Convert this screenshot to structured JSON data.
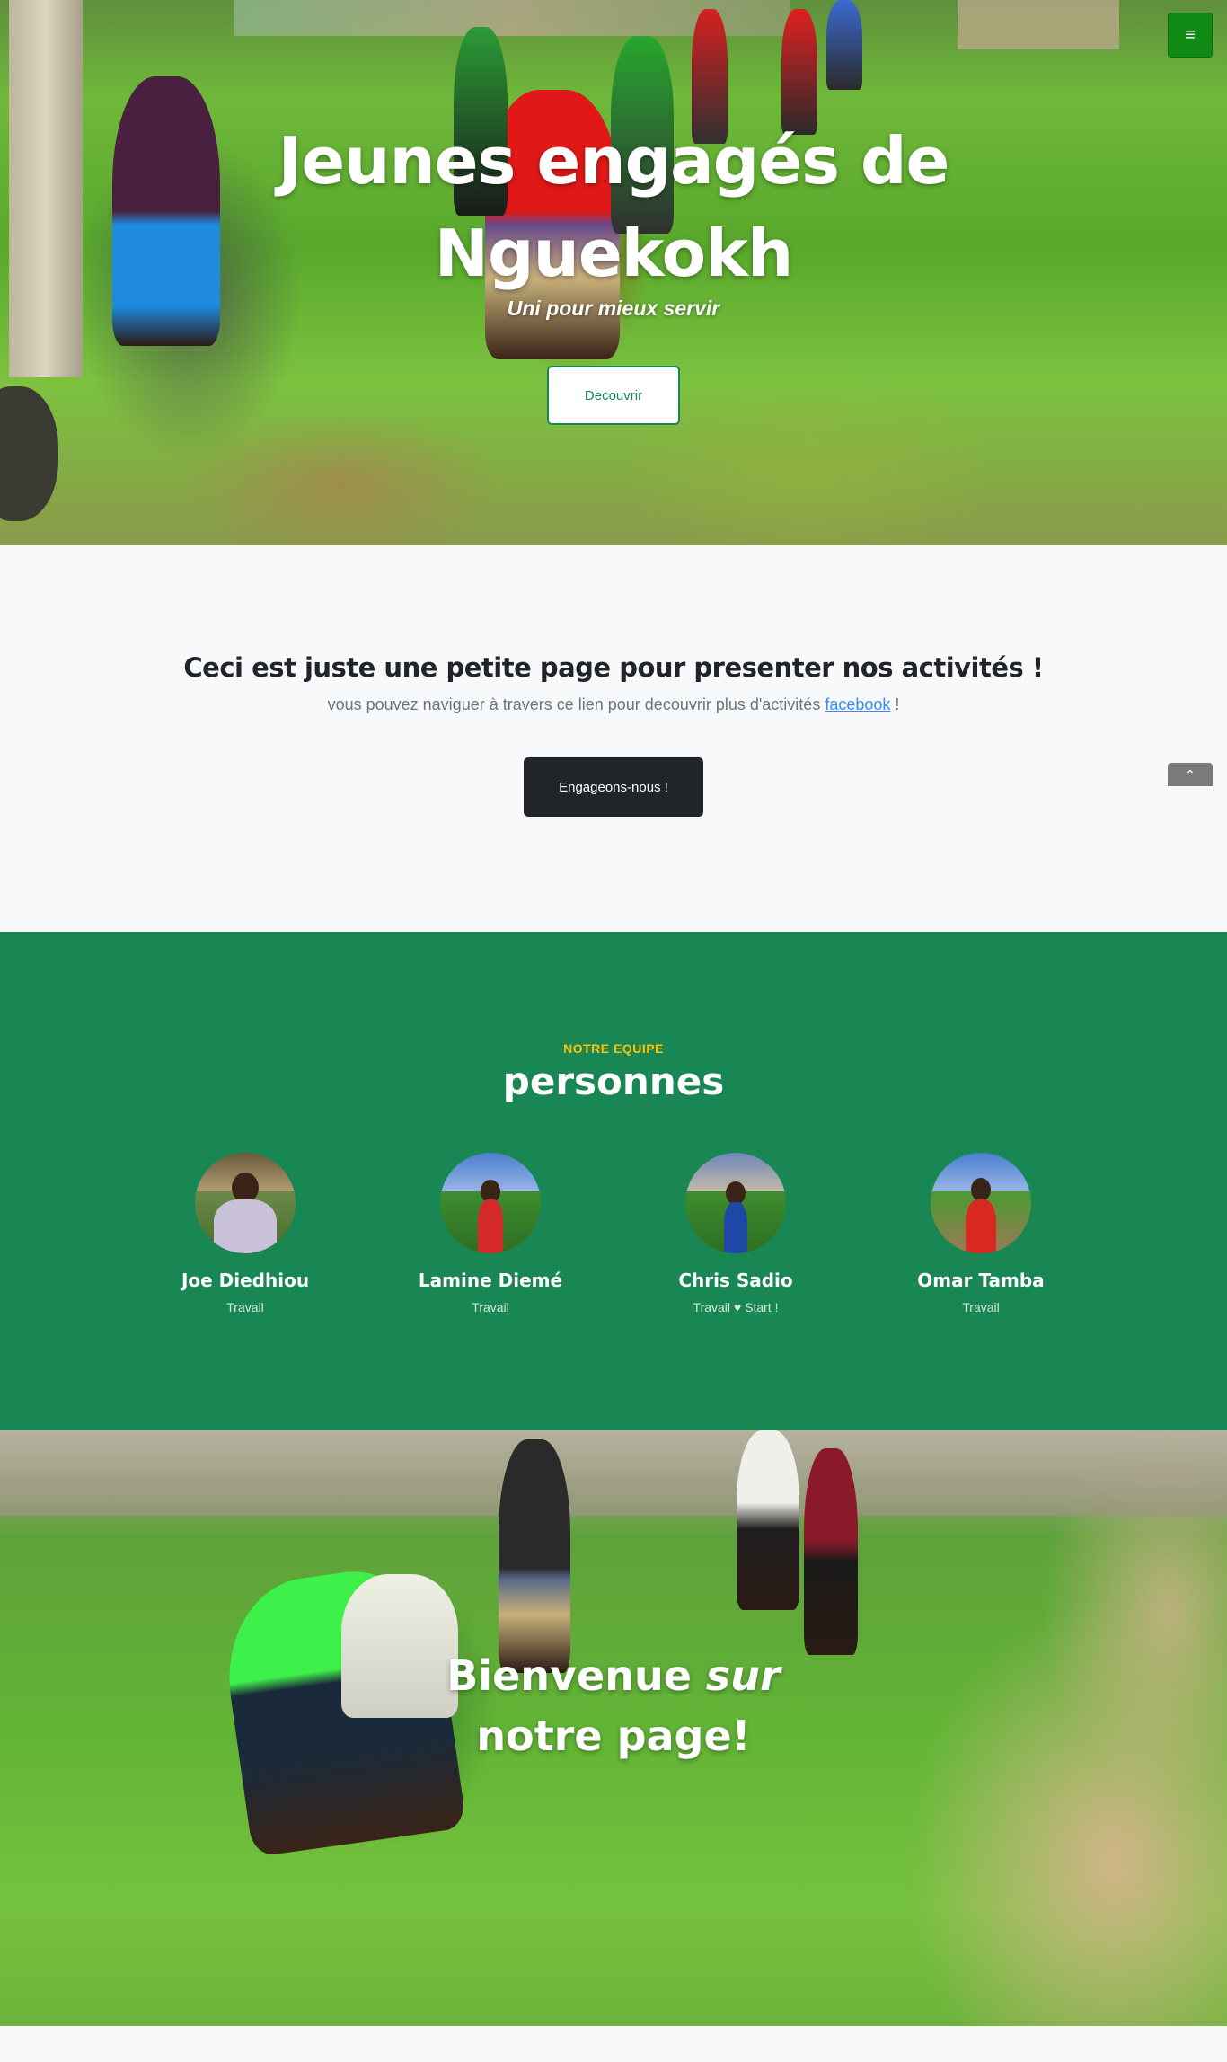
{
  "hero": {
    "title": "Jeunes engagés de Nguekokh",
    "subtitle": "Uni pour mieux servir",
    "button_label": "Decouvrir"
  },
  "nav": {
    "menu_icon": "hamburger-icon",
    "menu_glyph": "≡"
  },
  "cta": {
    "heading": "Ceci est juste une petite page pour presenter nos activités !",
    "text_before": "vous pouvez naviguer à travers ce lien pour decouvrir plus d'activités ",
    "link_label": "facebook",
    "text_after": " !",
    "button_label": "Engageons-nous !"
  },
  "scroll_top": {
    "icon": "chevron-up-icon",
    "glyph": "⌃"
  },
  "team": {
    "eyebrow": "NOTRE EQUIPE",
    "title": "personnes",
    "members": [
      {
        "name": "Joe Diedhiou",
        "role": "Travail",
        "shirt_color": "#c9c2d9"
      },
      {
        "name": "Lamine Diemé",
        "role": "Travail",
        "shirt_color": "#d42a2a"
      },
      {
        "name": "Chris Sadio",
        "role": "Travail ♥ Start !",
        "shirt_color": "#1f47a8"
      },
      {
        "name": "Omar Tamba",
        "role": "Travail",
        "shirt_color": "#d9281f"
      }
    ]
  },
  "welcome": {
    "title_part1": "Bienvenue ",
    "title_em": "sur",
    "title_part2": "notre page!"
  },
  "colors": {
    "primary_green": "#198754",
    "menu_green": "#0f8a15",
    "eyebrow_yellow": "#ffc107",
    "dark": "#212529"
  }
}
